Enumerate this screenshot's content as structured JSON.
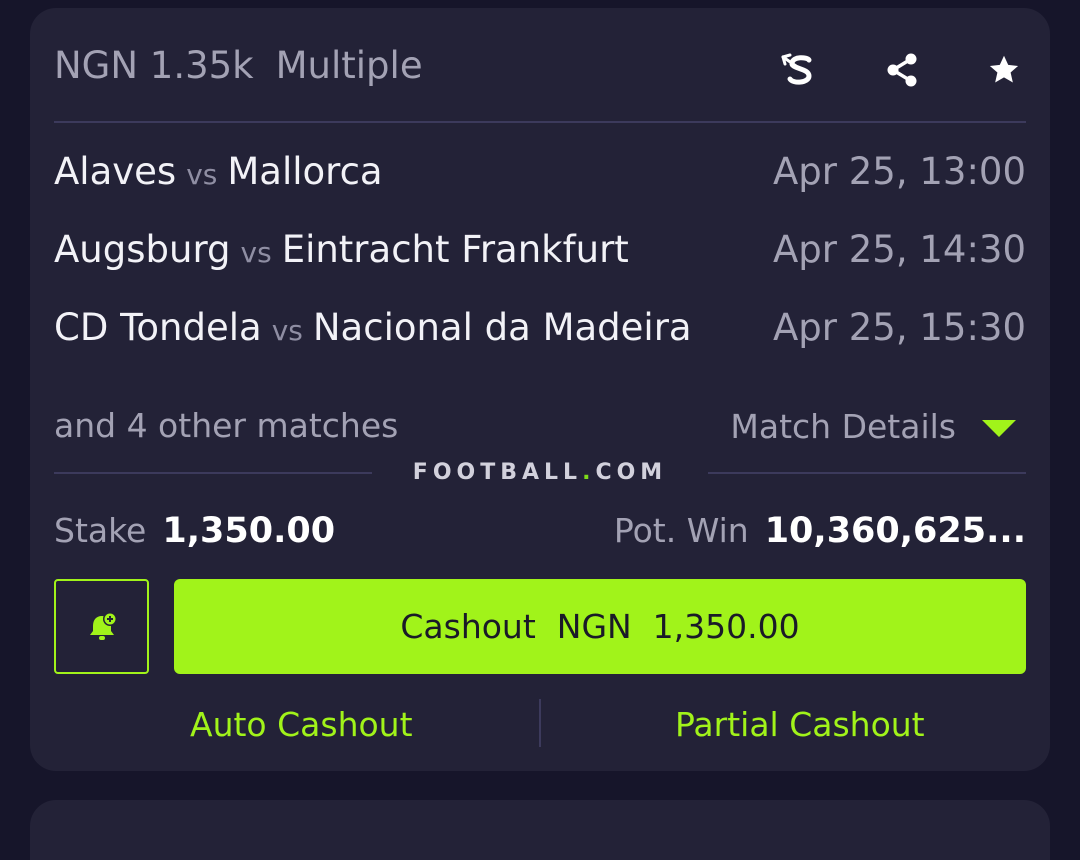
{
  "header": {
    "amount": "NGN 1.35k",
    "bet_type": "Multiple",
    "icons": [
      "sportybet-s-icon",
      "share-icon",
      "star-icon"
    ]
  },
  "matches": [
    {
      "home": "Alaves",
      "vs": "vs",
      "away": "Mallorca",
      "time": "Apr 25, 13:00"
    },
    {
      "home": "Augsburg",
      "vs": "vs",
      "away": "Eintracht Frankfurt",
      "time": "Apr 25, 14:30"
    },
    {
      "home": "CD Tondela",
      "vs": "vs",
      "away": "Nacional da Madeira",
      "time": "Apr 25, 15:30"
    }
  ],
  "others_text": "and 4 other matches",
  "match_details_label": "Match Details",
  "brand": {
    "part1": "FOOTBALL",
    "dot": ".",
    "part2": "COM"
  },
  "stake": {
    "label": "Stake",
    "value": "1,350.00"
  },
  "pot_win": {
    "label": "Pot. Win",
    "value": "10,360,625..."
  },
  "cashout_button": "Cashout  NGN  1,350.00",
  "auto_cashout": "Auto Cashout",
  "partial_cashout": "Partial Cashout",
  "colors": {
    "accent": "#a1f31a",
    "card_bg": "#232237",
    "page_bg": "#16152a"
  }
}
